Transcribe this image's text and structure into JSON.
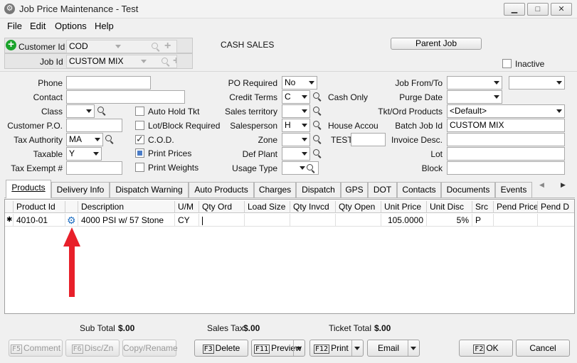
{
  "window": {
    "title": "Job Price Maintenance - Test",
    "controls": {
      "minimize": "▁",
      "maximize": "□",
      "close": "✕"
    }
  },
  "menu": [
    "File",
    "Edit",
    "Options",
    "Help"
  ],
  "header": {
    "customer_id_label": "Customer Id",
    "customer_id_value": "COD",
    "customer_name": "CASH SALES",
    "job_id_label": "Job Id",
    "job_id_value": "CUSTOM MIX",
    "parent_job_label": "Parent Job",
    "inactive_label": "Inactive"
  },
  "form": {
    "phone_label": "Phone",
    "phone_value": "",
    "contact_label": "Contact",
    "contact_value": "",
    "class_label": "Class",
    "class_value": "",
    "customer_po_label": "Customer P.O.",
    "customer_po_value": "",
    "tax_authority_label": "Tax Authority",
    "tax_authority_value": "MA",
    "taxable_label": "Taxable",
    "taxable_value": "Y",
    "tax_exempt_label": "Tax Exempt #",
    "tax_exempt_value": "",
    "auto_hold_label": "Auto Hold Tkt",
    "lot_block_label": "Lot/Block Required",
    "cod_label": "C.O.D.",
    "print_prices_label": "Print Prices",
    "print_weights_label": "Print Weights",
    "po_required_label": "PO Required",
    "po_required_value": "No",
    "credit_terms_label": "Credit Terms",
    "credit_terms_value": "C",
    "credit_terms_desc": "Cash Only",
    "sales_territory_label": "Sales territory",
    "sales_territory_value": "",
    "salesperson_label": "Salesperson",
    "salesperson_value": "H",
    "salesperson_desc": "House Accou",
    "zone_label": "Zone",
    "zone_value": "",
    "zone_desc": "TEST",
    "def_plant_label": "Def Plant",
    "def_plant_value": "",
    "usage_type_label": "Usage Type",
    "usage_type_value": "",
    "job_from_to_label": "Job From/To",
    "purge_date_label": "Purge Date",
    "tkt_ord_products_label": "Tkt/Ord Products",
    "tkt_ord_products_value": "<Default>",
    "batch_job_id_label": "Batch Job Id",
    "batch_job_id_value": "CUSTOM MIX",
    "invoice_desc_label": "Invoice Desc.",
    "invoice_desc_value": "",
    "lot_label": "Lot",
    "lot_value": "",
    "block_label": "Block",
    "block_value": ""
  },
  "tabs": [
    "Products",
    "Delivery Info",
    "Dispatch Warning",
    "Auto Products",
    "Charges",
    "Dispatch",
    "GPS",
    "DOT",
    "Contacts",
    "Documents",
    "Events"
  ],
  "tab_scroll": {
    "left": "◀",
    "right": "▶"
  },
  "grid": {
    "columns": [
      "Product Id",
      "",
      "Description",
      "U/M",
      "Qty Ord",
      "Load Size",
      "Qty Invcd",
      "Qty Open",
      "Unit Price",
      "Unit Disc",
      "Src",
      "Pend Price",
      "Pend D"
    ],
    "rows": [
      {
        "marker": "✱",
        "product_id": "4010-01",
        "description": "4000 PSI w/ 57 Stone",
        "um": "CY",
        "qty_ord": "",
        "load_size": "",
        "qty_invcd": "",
        "qty_open": "",
        "unit_price": "105.0000",
        "unit_disc": "5%",
        "src": "P",
        "pend_price": "",
        "pend_d": ""
      }
    ]
  },
  "totals": {
    "subtotal_label": "Sub Total",
    "subtotal_value": "$.00",
    "sales_tax_label": "Sales Tax",
    "sales_tax_value": "$.00",
    "ticket_total_label": "Ticket Total",
    "ticket_total_value": "$.00"
  },
  "buttons": {
    "comment_key": "F5",
    "comment": "Comment",
    "disczn_key": "F6",
    "disczn": "Disc/Zn",
    "copy_rename": "Copy/Rename",
    "delete_key": "F3",
    "delete": "Delete",
    "preview_key": "F11",
    "preview": "Preview",
    "print_key": "F12",
    "print": "Print",
    "email": "Email",
    "ok_key": "F2",
    "ok": "OK",
    "cancel": "Cancel"
  },
  "colors": {
    "add_icon": "#1aa32b",
    "gear_icon": "#1f6fc2",
    "arrow": "#e8202a",
    "print_prices_check": "#4a7cc7"
  }
}
